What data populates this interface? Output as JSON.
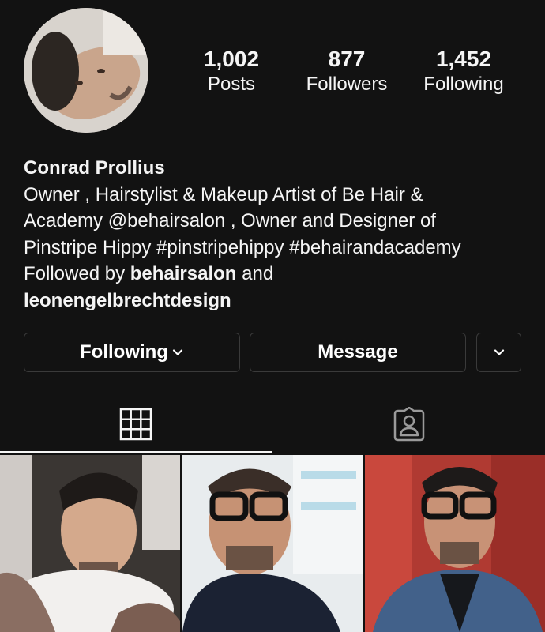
{
  "profile": {
    "stats": {
      "posts": {
        "value": "1,002",
        "label": "Posts"
      },
      "followers": {
        "value": "877",
        "label": "Followers"
      },
      "following": {
        "value": "1,452",
        "label": "Following"
      }
    },
    "name": "Conrad Prollius",
    "bio_line1": "Owner , Hairstylist & Makeup Artist of Be Hair &",
    "bio_line2": "Academy @behairsalon , Owner and Designer of",
    "bio_line3": "Pinstripe Hippy #pinstripehippy #behairandacademy",
    "followed_by_prefix": "Followed by ",
    "followed_by_user1": "behairsalon",
    "followed_by_and": " and",
    "followed_by_user2": "leonengelbrechtdesign"
  },
  "actions": {
    "following_label": "Following",
    "message_label": "Message",
    "more_icon": "chevron-down-icon"
  },
  "tabs": {
    "grid_icon": "grid-icon",
    "tagged_icon": "tagged-person-icon"
  },
  "posts": [
    "post-photo",
    "post-photo",
    "post-photo"
  ],
  "colors": {
    "background": "#121212",
    "text": "#f5f5f5",
    "button_border": "#3a3a3a"
  }
}
